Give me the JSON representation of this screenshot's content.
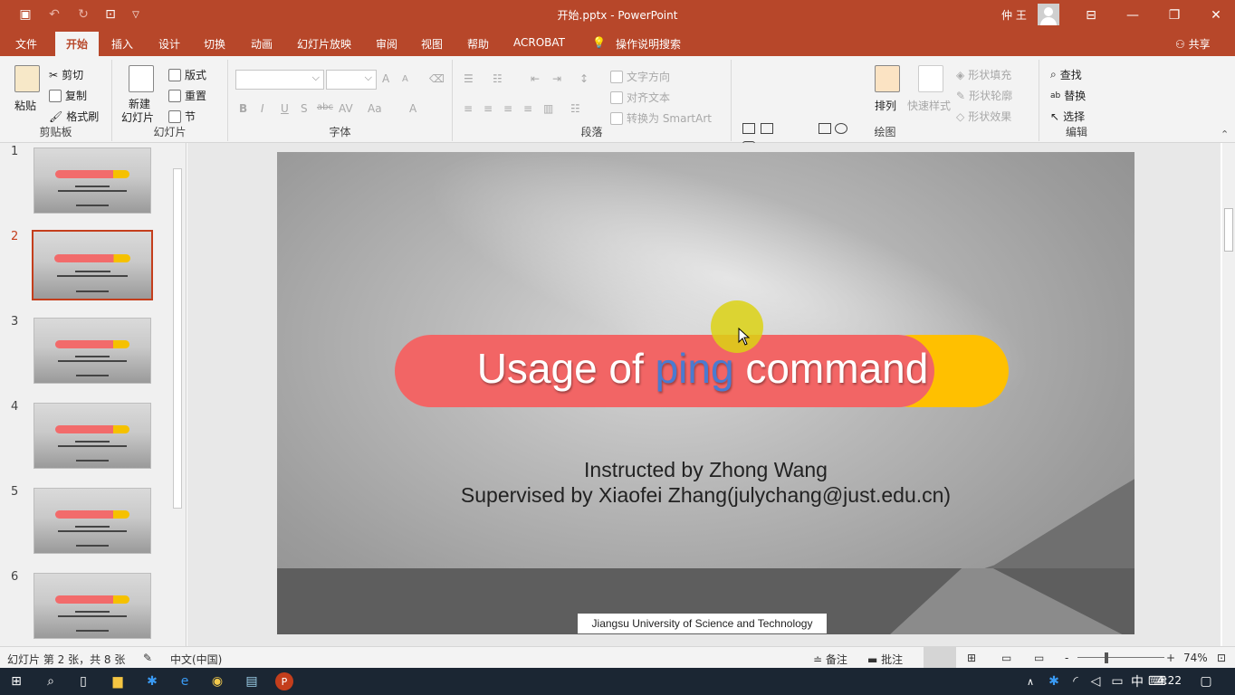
{
  "window": {
    "title": "开始.pptx  -  PowerPoint",
    "user": "仲 王"
  },
  "tabs": [
    {
      "label": "文件"
    },
    {
      "label": "开始",
      "active": true
    },
    {
      "label": "插入"
    },
    {
      "label": "设计"
    },
    {
      "label": "切换"
    },
    {
      "label": "动画"
    },
    {
      "label": "幻灯片放映"
    },
    {
      "label": "审阅"
    },
    {
      "label": "视图"
    },
    {
      "label": "帮助"
    },
    {
      "label": "ACROBAT"
    },
    {
      "label": "操作说明搜索"
    }
  ],
  "share_label": "共享",
  "ribbon": {
    "clipboard": {
      "group": "剪贴板",
      "paste": "粘贴",
      "cut": "剪切",
      "copy": "复制",
      "format_painter": "格式刷"
    },
    "slides": {
      "group": "幻灯片",
      "new_slide_1": "新建",
      "new_slide_2": "幻灯片",
      "layout": "版式",
      "reset": "重置",
      "section": "节"
    },
    "font": {
      "group": "字体",
      "bold": "B",
      "italic": "I",
      "underline": "U",
      "shadow": "S",
      "strike": "abc",
      "spacing": "AV",
      "case": "Aa",
      "color": "A",
      "grow": "A",
      "shrink": "A"
    },
    "paragraph": {
      "group": "段落",
      "text_direction": "文字方向",
      "align_text": "对齐文本",
      "smartart": "转换为 SmartArt"
    },
    "drawing": {
      "group": "绘图",
      "arrange": "排列",
      "quick_styles": "快速样式",
      "shape_fill": "形状填充",
      "shape_outline": "形状轮廓",
      "shape_effects": "形状效果"
    },
    "editing": {
      "group": "编辑",
      "find": "查找",
      "replace": "替换",
      "select": "选择"
    }
  },
  "thumbnails": [
    {
      "num": "1",
      "active": false
    },
    {
      "num": "2",
      "active": true
    },
    {
      "num": "3",
      "active": false
    },
    {
      "num": "4",
      "active": false
    },
    {
      "num": "5",
      "active": false
    },
    {
      "num": "6",
      "active": false
    }
  ],
  "slide": {
    "title_pre": "Usage of ",
    "title_kw": "ping",
    "title_post": " command",
    "line1": "Instructed by Zhong Wang",
    "line2": "Supervised by Xiaofei Zhang(julychang@just.edu.cn)",
    "footer": "Jiangsu University of Science and Technology"
  },
  "status": {
    "slide_info": "幻灯片 第 2 张，共 8 张",
    "language": "中文(中国)",
    "notes": "备注",
    "comments": "批注",
    "zoom": "74%",
    "minus": "-",
    "plus": "+"
  },
  "taskbar": {
    "ime": "中",
    "time": "4:22"
  },
  "colors": {
    "accent": "#b7472a",
    "title_pill": "#f26565",
    "title_pill_back": "#ffc000",
    "keyword": "#4a7bd0"
  }
}
